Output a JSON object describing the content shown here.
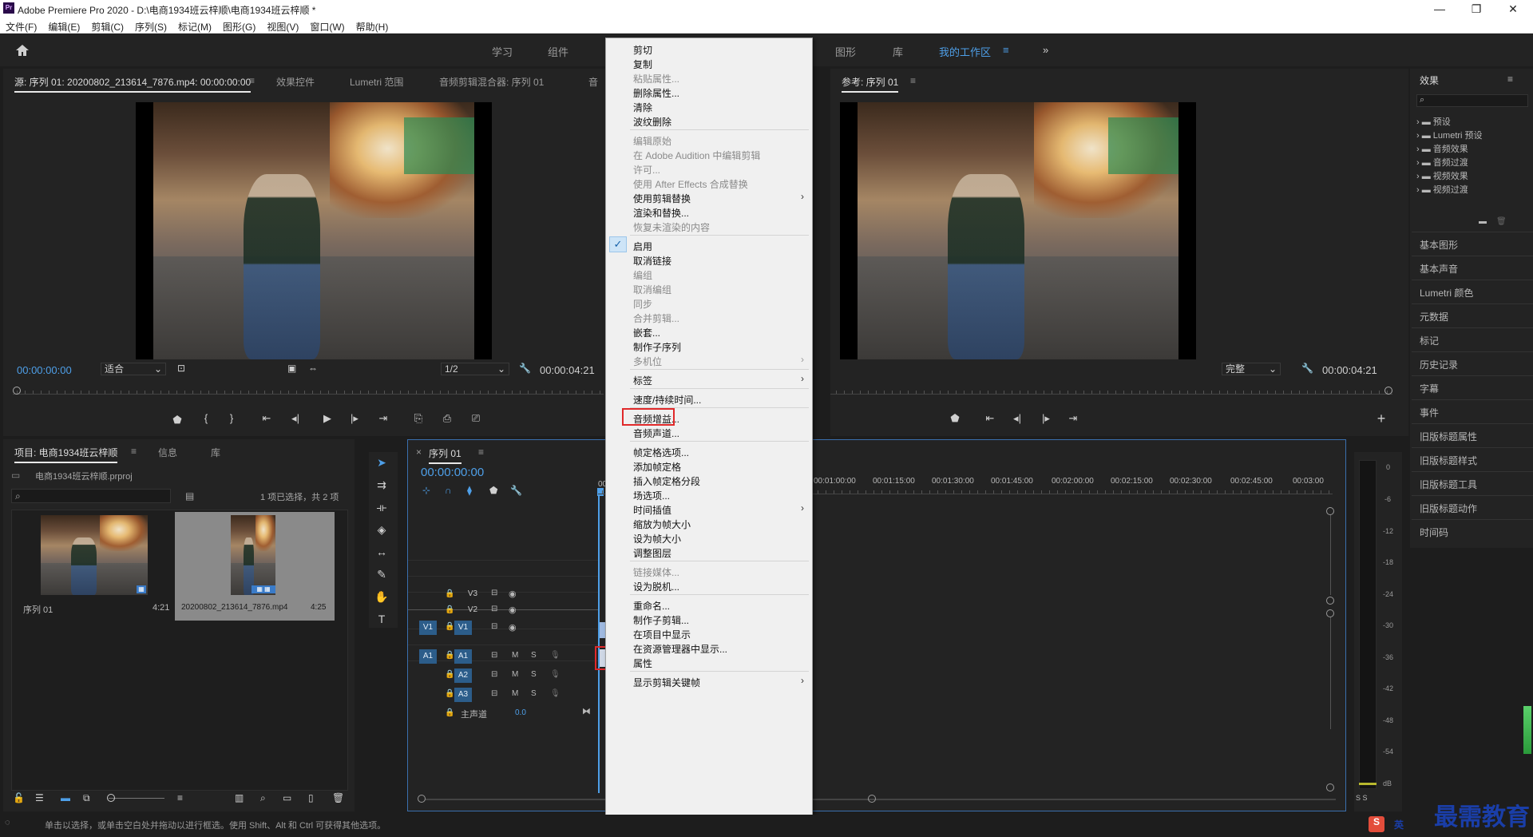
{
  "window": {
    "title": "Adobe Premiere Pro 2020 - D:\\电商1934班云梓顺\\电商1934班云梓顺 *",
    "logo": "Pr",
    "minimize": "—",
    "maximize": "❐",
    "close": "✕"
  },
  "menu": [
    "文件(F)",
    "编辑(E)",
    "剪辑(C)",
    "序列(S)",
    "标记(M)",
    "图形(G)",
    "视图(V)",
    "窗口(W)",
    "帮助(H)"
  ],
  "workspaces": {
    "items": [
      "学习",
      "组件",
      "图形",
      "库",
      "我的工作区"
    ],
    "active": "我的工作区",
    "overflow": "»"
  },
  "source_panel": {
    "tabs": [
      "源: 序列 01: 20200802_213614_7876.mp4: 00:00:00:00",
      "效果控件",
      "Lumetri 范围",
      "音频剪辑混合器: 序列 01",
      "音"
    ],
    "timecode_in": "00:00:00:00",
    "fit": "适合",
    "resolution": "1/2",
    "timecode_out": "00:00:04:21"
  },
  "program_panel": {
    "tab": "参考: 序列 01",
    "quality": "完整",
    "timecode_out": "00:00:04:21"
  },
  "project_panel": {
    "tabs": [
      "项目: 电商1934班云梓顺",
      "信息",
      "库"
    ],
    "file": "电商1934班云梓顺.prproj",
    "selection": "1 项已选择，共 2 项",
    "items": [
      {
        "name": "序列 01",
        "duration": "4:21"
      },
      {
        "name": "20200802_213614_7876.mp4",
        "duration": "4:25"
      }
    ]
  },
  "timeline": {
    "tab": "序列 01",
    "timecode": "00:00:00:00",
    "ruler": [
      "00:00",
      "00:01:00:00",
      "00:01:15:00",
      "00:01:30:00",
      "00:01:45:00",
      "00:02:00:00",
      "00:02:15:00",
      "00:02:30:00",
      "00:02:45:00",
      "00:03:00"
    ],
    "video_tracks": [
      "V3",
      "V2",
      "V1"
    ],
    "audio_tracks": [
      "A1",
      "A2",
      "A3"
    ],
    "source_v": "V1",
    "source_a": "A1",
    "master": {
      "label": "主声道",
      "value": "0.0"
    },
    "mute": "M",
    "solo": "S"
  },
  "effects_panel": {
    "title": "效果",
    "tree": [
      "预设",
      "Lumetri 预设",
      "音频效果",
      "音频过渡",
      "视频效果",
      "视频过渡"
    ],
    "sections": [
      "基本图形",
      "基本声音",
      "Lumetri 颜色",
      "元数据",
      "标记",
      "历史记录",
      "字幕",
      "事件",
      "旧版标题属性",
      "旧版标题样式",
      "旧版标题工具",
      "旧版标题动作",
      "时间码"
    ]
  },
  "meter": {
    "scale": [
      "0",
      "-6",
      "-12",
      "-18",
      "-24",
      "-30",
      "-36",
      "-42",
      "-48",
      "-54",
      "dB"
    ],
    "channels": "S S"
  },
  "context_menu": {
    "groups": [
      [
        {
          "label": "剪切"
        },
        {
          "label": "复制"
        },
        {
          "label": "粘贴属性...",
          "disabled": true
        },
        {
          "label": "删除属性..."
        },
        {
          "label": "清除"
        },
        {
          "label": "波纹删除"
        }
      ],
      [
        {
          "label": "编辑原始",
          "disabled": true
        },
        {
          "label": "在 Adobe Audition 中编辑剪辑",
          "disabled": true
        },
        {
          "label": "许可...",
          "disabled": true
        },
        {
          "label": "使用 After Effects 合成替换",
          "disabled": true
        },
        {
          "label": "使用剪辑替换",
          "submenu": true
        },
        {
          "label": "渲染和替换..."
        },
        {
          "label": "恢复未渲染的内容",
          "disabled": true
        }
      ],
      [
        {
          "label": "启用",
          "checked": true
        },
        {
          "label": "取消链接"
        },
        {
          "label": "编组",
          "disabled": true
        },
        {
          "label": "取消编组",
          "disabled": true
        },
        {
          "label": "同步",
          "disabled": true
        },
        {
          "label": "合并剪辑...",
          "disabled": true
        },
        {
          "label": "嵌套..."
        },
        {
          "label": "制作子序列"
        },
        {
          "label": "多机位",
          "disabled": true,
          "submenu": true
        }
      ],
      [
        {
          "label": "标签",
          "submenu": true
        }
      ],
      [
        {
          "label": "速度/持续时间..."
        }
      ],
      [
        {
          "label": "音频增益...",
          "highlighted": true
        },
        {
          "label": "音频声道..."
        }
      ],
      [
        {
          "label": "帧定格选项..."
        },
        {
          "label": "添加帧定格"
        },
        {
          "label": "插入帧定格分段"
        },
        {
          "label": "场选项..."
        },
        {
          "label": "时间插值",
          "submenu": true
        },
        {
          "label": "缩放为帧大小"
        },
        {
          "label": "设为帧大小"
        },
        {
          "label": "调整图层"
        }
      ],
      [
        {
          "label": "链接媒体...",
          "disabled": true
        },
        {
          "label": "设为脱机..."
        }
      ],
      [
        {
          "label": "重命名..."
        },
        {
          "label": "制作子剪辑..."
        },
        {
          "label": "在项目中显示"
        },
        {
          "label": "在资源管理器中显示..."
        },
        {
          "label": "属性"
        }
      ],
      [
        {
          "label": "显示剪辑关键帧",
          "submenu": true
        }
      ]
    ]
  },
  "statusbar": {
    "text": "单击以选择，或单击空白处并拖动以进行框选。使用 Shift、Alt 和 Ctrl 可获得其他选项。"
  },
  "watermark": {
    "ime": "英",
    "text": "最需教育"
  },
  "colors": {
    "accent": "#4e9fe8",
    "track_blue": "#2c5d8a",
    "highlight_red": "#e0292a",
    "panel_bg": "#232323",
    "menu_bg": "#f0f0f0"
  }
}
